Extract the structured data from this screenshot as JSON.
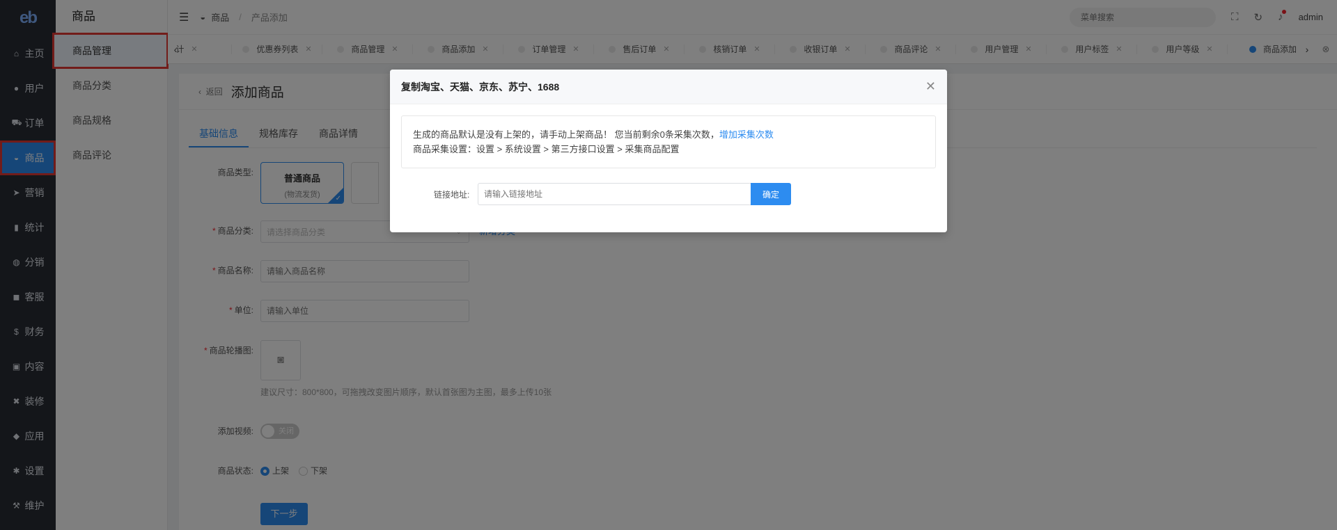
{
  "logo": "eb",
  "sidebar": {
    "items": [
      {
        "label": "主页",
        "icon": "home-icon",
        "glyph": "⌂"
      },
      {
        "label": "用户",
        "icon": "user-icon",
        "glyph": "●"
      },
      {
        "label": "订单",
        "icon": "cart-icon",
        "glyph": "⛟"
      },
      {
        "label": "商品",
        "icon": "basket-icon",
        "glyph": "◒"
      },
      {
        "label": "营销",
        "icon": "send-icon",
        "glyph": "➤"
      },
      {
        "label": "统计",
        "icon": "bar-chart-icon",
        "glyph": "▮"
      },
      {
        "label": "分销",
        "icon": "handshake-icon",
        "glyph": "◍"
      },
      {
        "label": "客服",
        "icon": "chat-icon",
        "glyph": "◼"
      },
      {
        "label": "财务",
        "icon": "dollar-icon",
        "glyph": "$"
      },
      {
        "label": "内容",
        "icon": "book-icon",
        "glyph": "▣"
      },
      {
        "label": "装修",
        "icon": "tools-icon",
        "glyph": "✖"
      },
      {
        "label": "应用",
        "icon": "cube-icon",
        "glyph": "◆"
      },
      {
        "label": "设置",
        "icon": "gear-icon",
        "glyph": "✱"
      },
      {
        "label": "维护",
        "icon": "hammer-icon",
        "glyph": "⚒"
      }
    ]
  },
  "subnav": {
    "title": "商品",
    "items": [
      "商品管理",
      "商品分类",
      "商品规格",
      "商品评论"
    ]
  },
  "topbar": {
    "breadcrumb_root": "商品",
    "breadcrumb_current": "产品添加",
    "search_placeholder": "菜单搜索",
    "user": "admin"
  },
  "tabs": [
    {
      "label": "计"
    },
    {
      "label": "优惠券列表"
    },
    {
      "label": "商品管理"
    },
    {
      "label": "商品添加"
    },
    {
      "label": "订单管理"
    },
    {
      "label": "售后订单"
    },
    {
      "label": "核销订单"
    },
    {
      "label": "收银订单"
    },
    {
      "label": "商品评论"
    },
    {
      "label": "用户管理"
    },
    {
      "label": "用户标签"
    },
    {
      "label": "用户等级"
    },
    {
      "label": "商品添加"
    }
  ],
  "page": {
    "back": "返回",
    "title": "添加商品",
    "form_tabs": [
      "基础信息",
      "规格库存",
      "商品详情"
    ],
    "type_label": "商品类型:",
    "type_name": "普通商品",
    "type_sub": "(物流发货)",
    "category_label": "商品分类:",
    "category_placeholder": "请选择商品分类",
    "add_category": "新增分类",
    "name_label": "商品名称:",
    "name_placeholder": "请输入商品名称",
    "unit_label": "单位:",
    "unit_placeholder": "请输入单位",
    "image_label": "商品轮播图:",
    "image_hint": "建议尺寸：800*800，可拖拽改变图片顺序，默认首张图为主图，最多上传10张",
    "video_label": "添加视频:",
    "video_switch": "关闭",
    "status_label": "商品状态:",
    "status_on": "上架",
    "status_off": "下架",
    "next": "下一步"
  },
  "modal": {
    "title": "复制淘宝、天猫、京东、苏宁、1688",
    "notice_line1": "生成的商品默认是没有上架的，请手动上架商品！ 您当前剩余0条采集次数，",
    "notice_link": "增加采集次数",
    "notice_line2": "商品采集设置：设置 > 系统设置 > 第三方接口设置 > 采集商品配置",
    "link_label": "链接地址:",
    "link_placeholder": "请输入链接地址",
    "confirm": "确定"
  }
}
